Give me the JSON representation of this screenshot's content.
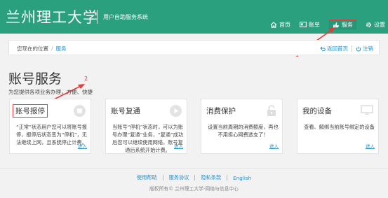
{
  "header": {
    "logo_text": "兰州理工大学",
    "subtitle": "用户自助服务系统",
    "nav": [
      {
        "label": "首页",
        "icon": "home-icon"
      },
      {
        "label": "账单",
        "icon": "bill-icon"
      },
      {
        "label": "服务",
        "icon": "service-icon"
      },
      {
        "label": "设置",
        "icon": "gear-icon"
      }
    ]
  },
  "breadcrumb": {
    "prefix": "您现在的位置",
    "separator": "/",
    "current": "服务",
    "back_label": "返回首页",
    "logout_label": "注销"
  },
  "page": {
    "title": "账号服务",
    "subtitle": "为您提供各项业务办理，方便、快捷"
  },
  "cards": [
    {
      "title": "账号报停",
      "icon": "stop-icon",
      "desc": "“正常”状态用户您可以将账号报停，报停后状态变为“停机”，无法继续上网，且系统停止计费。",
      "enter": "进入"
    },
    {
      "title": "账号复通",
      "icon": "play-icon",
      "desc": "当账号“停机”状态时，可以为账号办理“复通”业务，“复通”成功后您可以继续使用网络，账号复通后系统开始计费。",
      "enter": "进入"
    },
    {
      "title": "消费保护",
      "icon": "lock-icon",
      "desc": "设置当前周期的消费额度，再也不用担心网费透支了！",
      "enter": "进入"
    },
    {
      "title": "我的设备",
      "icon": "monitor-icon",
      "desc": "查看、解绑当前账号绑定的设备",
      "enter": "进入"
    }
  ],
  "annotations": {
    "nav_marker": "1",
    "card_marker": "2"
  },
  "footer": {
    "links": [
      "使用帮助",
      "服务协议",
      "隐私条款",
      "English"
    ],
    "copyright": "版权所有© 兰州理工大学-网络与信息中心"
  },
  "colors": {
    "brand": "#2aa07f",
    "link": "#2b8fc7",
    "annotation": "#e23b3b"
  }
}
